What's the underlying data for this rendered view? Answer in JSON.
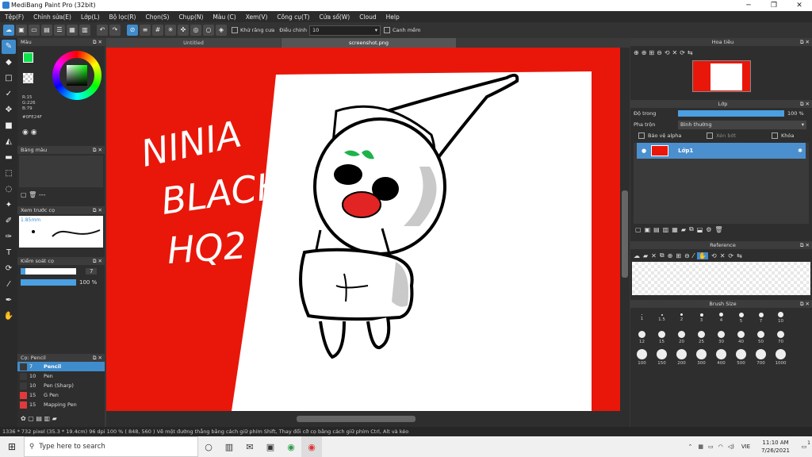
{
  "window": {
    "title": "MediBang Paint Pro (32bit)"
  },
  "menu": [
    "Tệp(F)",
    "Chỉnh sửa(E)",
    "Lớp(L)",
    "Bộ lọc(R)",
    "Chọn(S)",
    "Chụp(N)",
    "Màu (C)",
    "Xem(V)",
    "Công cụ(T)",
    "Cửa số(W)",
    "Cloud",
    "Help"
  ],
  "toolbar": {
    "antialias_label": "Khử răng cưa",
    "adjust_label": "Điều chỉnh",
    "adjust_value": "10",
    "snap_label": "Canh mềm"
  },
  "tabs": [
    "Untitled",
    "screenshot.png"
  ],
  "color_panel": {
    "title": "Màu",
    "r": "R:15",
    "g": "G:226",
    "b": "B:79",
    "hex": "#0FE24F"
  },
  "palette_panel": {
    "title": "Bảng màu",
    "dash": "---"
  },
  "preview_panel": {
    "title": "Xem trước cọ",
    "size": "1.85mm"
  },
  "brush_control": {
    "title": "Kiểm soát cọ",
    "size_value": "7",
    "opacity_value": "100 %"
  },
  "brush_list": {
    "title": "Cọ: Pencil",
    "items": [
      {
        "size": "7",
        "name": "Pencil",
        "color": "#3a3a3a",
        "selected": true
      },
      {
        "size": "10",
        "name": "Pen",
        "color": "#3a3a3a",
        "selected": false
      },
      {
        "size": "10",
        "name": "Pen (Sharp)",
        "color": "#3a3a3a",
        "selected": false
      },
      {
        "size": "15",
        "name": "G Pen",
        "color": "#e03a3a",
        "selected": false
      },
      {
        "size": "15",
        "name": "Mapping Pen",
        "color": "#e03a3a",
        "selected": false
      }
    ]
  },
  "navigator": {
    "title": "Hoa tiêu"
  },
  "layers": {
    "title": "Lớp",
    "opacity_label": "Độ trong",
    "opacity_value": "100 %",
    "blend_label": "Pha trộn",
    "blend_value": "Bình thường",
    "protect_alpha": "Bảo vệ alpha",
    "clipping": "Xén bớt",
    "lock": "Khóa",
    "layer_name": "Lớp1"
  },
  "reference": {
    "title": "Reference"
  },
  "brush_size": {
    "title": "Brush Size",
    "sizes": [
      "1",
      "1.5",
      "2",
      "3",
      "4",
      "5",
      "7",
      "10",
      "12",
      "15",
      "20",
      "25",
      "30",
      "40",
      "50",
      "70",
      "100",
      "150",
      "200",
      "300",
      "400",
      "500",
      "700",
      "1000"
    ]
  },
  "canvas_text": [
    "NINIA",
    "BLACK",
    "HQ2 4?"
  ],
  "status": "1336 * 732 pixel  (35.3 * 19.4cm)  96 dpi  100 %  ( 848, 560 )  Vẽ một đường thẳng bằng cách giữ phím Shift, Thay đổi cỡ cọ bằng cách giữ phím Ctrl, Alt và kéo",
  "taskbar": {
    "search_placeholder": "Type here to search",
    "language": "VIE",
    "time": "11:10 AM",
    "date": "7/26/2021",
    "notify_count": "1"
  },
  "colors": {
    "accent": "#3f8ccc",
    "canvas_red": "#e8170a",
    "fg_color": "#0FE24F"
  }
}
